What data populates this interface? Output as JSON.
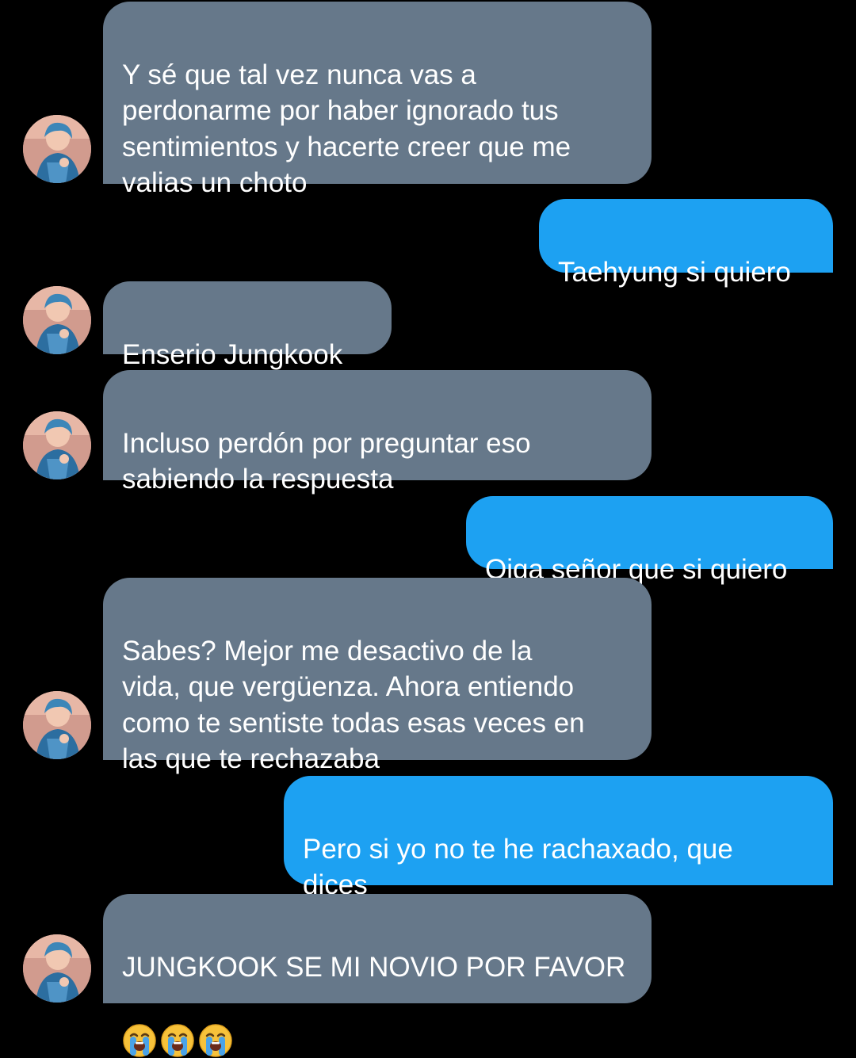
{
  "conversation": {
    "messages": [
      {
        "direction": "received",
        "text": "Y sé que tal vez nunca vas a\nperdonarme por haber ignorado tus\nsentimientos y hacerte creer que me\nvalias un choto"
      },
      {
        "direction": "sent",
        "text": "Taehyung si quiero"
      },
      {
        "direction": "received",
        "text": "Enserio Jungkook"
      },
      {
        "direction": "received",
        "text": "Incluso perdón por preguntar eso\nsabiendo la respuesta"
      },
      {
        "direction": "sent",
        "text": "Oiga señor que si quiero"
      },
      {
        "direction": "received",
        "text": "Sabes? Mejor me desactivo de la\nvida, que vergüenza. Ahora entiendo\ncomo te sentiste todas esas veces en\nlas que te rechazaba"
      },
      {
        "direction": "sent",
        "text": "Pero si yo no te he rachaxado, que\ndices"
      },
      {
        "direction": "received",
        "text": "JUNGKOOK SE MI NOVIO POR FAVOR",
        "emoji": [
          "loudly-crying-face",
          "loudly-crying-face",
          "loudly-crying-face"
        ]
      }
    ]
  },
  "theme": {
    "background": "#000000",
    "received_bubble": "#66788a",
    "sent_bubble": "#1da1f2",
    "text": "#ffffff"
  },
  "icons": {
    "avatar": "contact-avatar-photo",
    "emoji": "loudly-crying-face"
  }
}
